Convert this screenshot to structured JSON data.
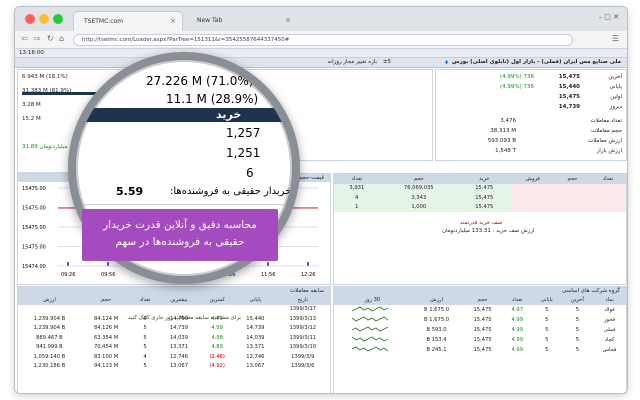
{
  "browser": {
    "tab1": "TSETMC.com",
    "tab2": "New Tab",
    "tab_close": "×",
    "url": "http://tsetmc.com/Loader.aspx?ParTree=151311&i=35425587644337450#",
    "window_controls": "–  ▢  ✕",
    "colors": {
      "red": "#ff5f56",
      "yellow": "#ffbd2e",
      "green": "#27c93f"
    }
  },
  "app": {
    "time": "13:18:00",
    "title": "ملی صنایع مس ایران (فملی) - بازار اول (تابلوی اصلی) بورس",
    "price_range_label": "بازه تغییر مجاز روزانه",
    "price_range_value": "±5",
    "buyer_power_value": "5.59",
    "summary": {
      "rows": [
        {
          "label": "آخرین",
          "value": "15,475",
          "change": "(4.99%)  736"
        },
        {
          "label": "پایانی",
          "value": "15,440",
          "change": "(4.99%)  736"
        },
        {
          "label": "اولین",
          "value": "15,475"
        },
        {
          "label": "دیروز",
          "value": "14,739"
        }
      ],
      "trade_rows": [
        {
          "label": "تعداد معاملات",
          "value": "3,476"
        },
        {
          "label": "حجم معاملات",
          "value": "38.313 M"
        },
        {
          "label": "ارزش معاملات",
          "value": "593.093 B"
        },
        {
          "label": "ارزش بازار",
          "value": "1,548 T"
        }
      ]
    },
    "magnifier": {
      "row1_value": "27.226 M (71.0%)",
      "row2_value": "11.1 M (28.9%)",
      "buy_header": "خرید",
      "counts": [
        "1,257",
        "1,251",
        "6"
      ],
      "buyer_power_text": "قدرت خریدار حقیقی به فروشنده‌ها:"
    },
    "callout": {
      "line1": "محاسبه دقیق و آنلاین قدرت خریدار",
      "line2": "حقیقی به فروشنده‌ها در سهم"
    },
    "orderbook": {
      "headers": [
        "تعداد",
        "حجم",
        "خرید",
        "فروش",
        "حجم",
        "تعداد"
      ],
      "rows": [
        [
          "3,931",
          "76,069,035",
          "15,475",
          "",
          "",
          ""
        ],
        [
          "4",
          "3,343",
          "15,475",
          "",
          "",
          ""
        ],
        [
          "1",
          "1,000",
          "15,475",
          "",
          "",
          ""
        ]
      ],
      "queue_text": "صف خرید قدرتمند",
      "queue_value": "ارزش صف خرید : 133.31 میلیاردتومان"
    },
    "chart": {
      "title": "قیمت-حجم در طول روز",
      "y_ticks": [
        "15475.00",
        "15475.00",
        "15475.00",
        "15475.00",
        "15474.00"
      ],
      "x_ticks": [
        "09:26",
        "09:56",
        "10:26",
        "10:56",
        "11:26",
        "11:56",
        "12:26"
      ]
    },
    "history": {
      "title": "سابقه معاملات",
      "headers": [
        "تاریخ",
        "پایانی",
        "کمترین",
        "بیشترین",
        "تعداد",
        "حجم",
        "ارزش"
      ],
      "rows": [
        [
          "1399/3/17",
          "",
          "",
          "",
          "",
          "",
          ""
        ],
        [
          "1399/3/13",
          "15,440",
          "4.73",
          "14,739",
          "5",
          "84.124 M",
          "1,239.904 B"
        ],
        [
          "1399/3/12",
          "14,739",
          "4.99",
          "14,739",
          "5",
          "84.126 M",
          "1,239.904 B"
        ],
        [
          "1399/3/11",
          "14,039",
          "4.98",
          "14,039",
          "5",
          "63.354 M",
          "889.467 B"
        ],
        [
          "1399/3/10",
          "13,371",
          "4.89",
          "13,371",
          "5",
          "70.454 M",
          "941.999 B"
        ],
        [
          "1399/3/9",
          "12,746",
          "(2.46)",
          "12,746",
          "4",
          "83.100 M",
          "1,059.140 B"
        ],
        [
          "1399/3/6",
          "13,067",
          "(4.92)",
          "13,067",
          "5",
          "94.123 M",
          "1,230.186 B"
        ]
      ],
      "note": "برای مشاهده سابقه معاملات روز جاری کلیک کنید"
    },
    "group": {
      "title": "گروه شرکت های اساسی",
      "headers": [
        "نماد",
        "آخرین",
        "پایانی",
        "تعداد",
        "حجم",
        "ارزش",
        "30 روز"
      ],
      "rows": [
        [
          "فولاد",
          "5",
          "5",
          "4.97",
          "15,475",
          "1,675.0 B",
          ""
        ],
        [
          "فخوز",
          "5",
          "5",
          "4.99",
          "15,475",
          "1,675.0 B",
          ""
        ],
        [
          "فملی",
          "5",
          "5",
          "4.99",
          "15,475",
          "593.0 B",
          ""
        ],
        [
          "کچاد",
          "5",
          "5",
          "4.99",
          "15,475",
          "153.4 B",
          ""
        ],
        [
          "فخاس",
          "5",
          "5",
          "4.99",
          "15,475",
          "245.1 B",
          ""
        ]
      ]
    },
    "left_values": [
      "6.943 M (18.1%)",
      "31.383 M (81.9%)",
      "3.28 M",
      "15.2 M",
      "",
      "میلیاردتومان 31.89"
    ]
  }
}
